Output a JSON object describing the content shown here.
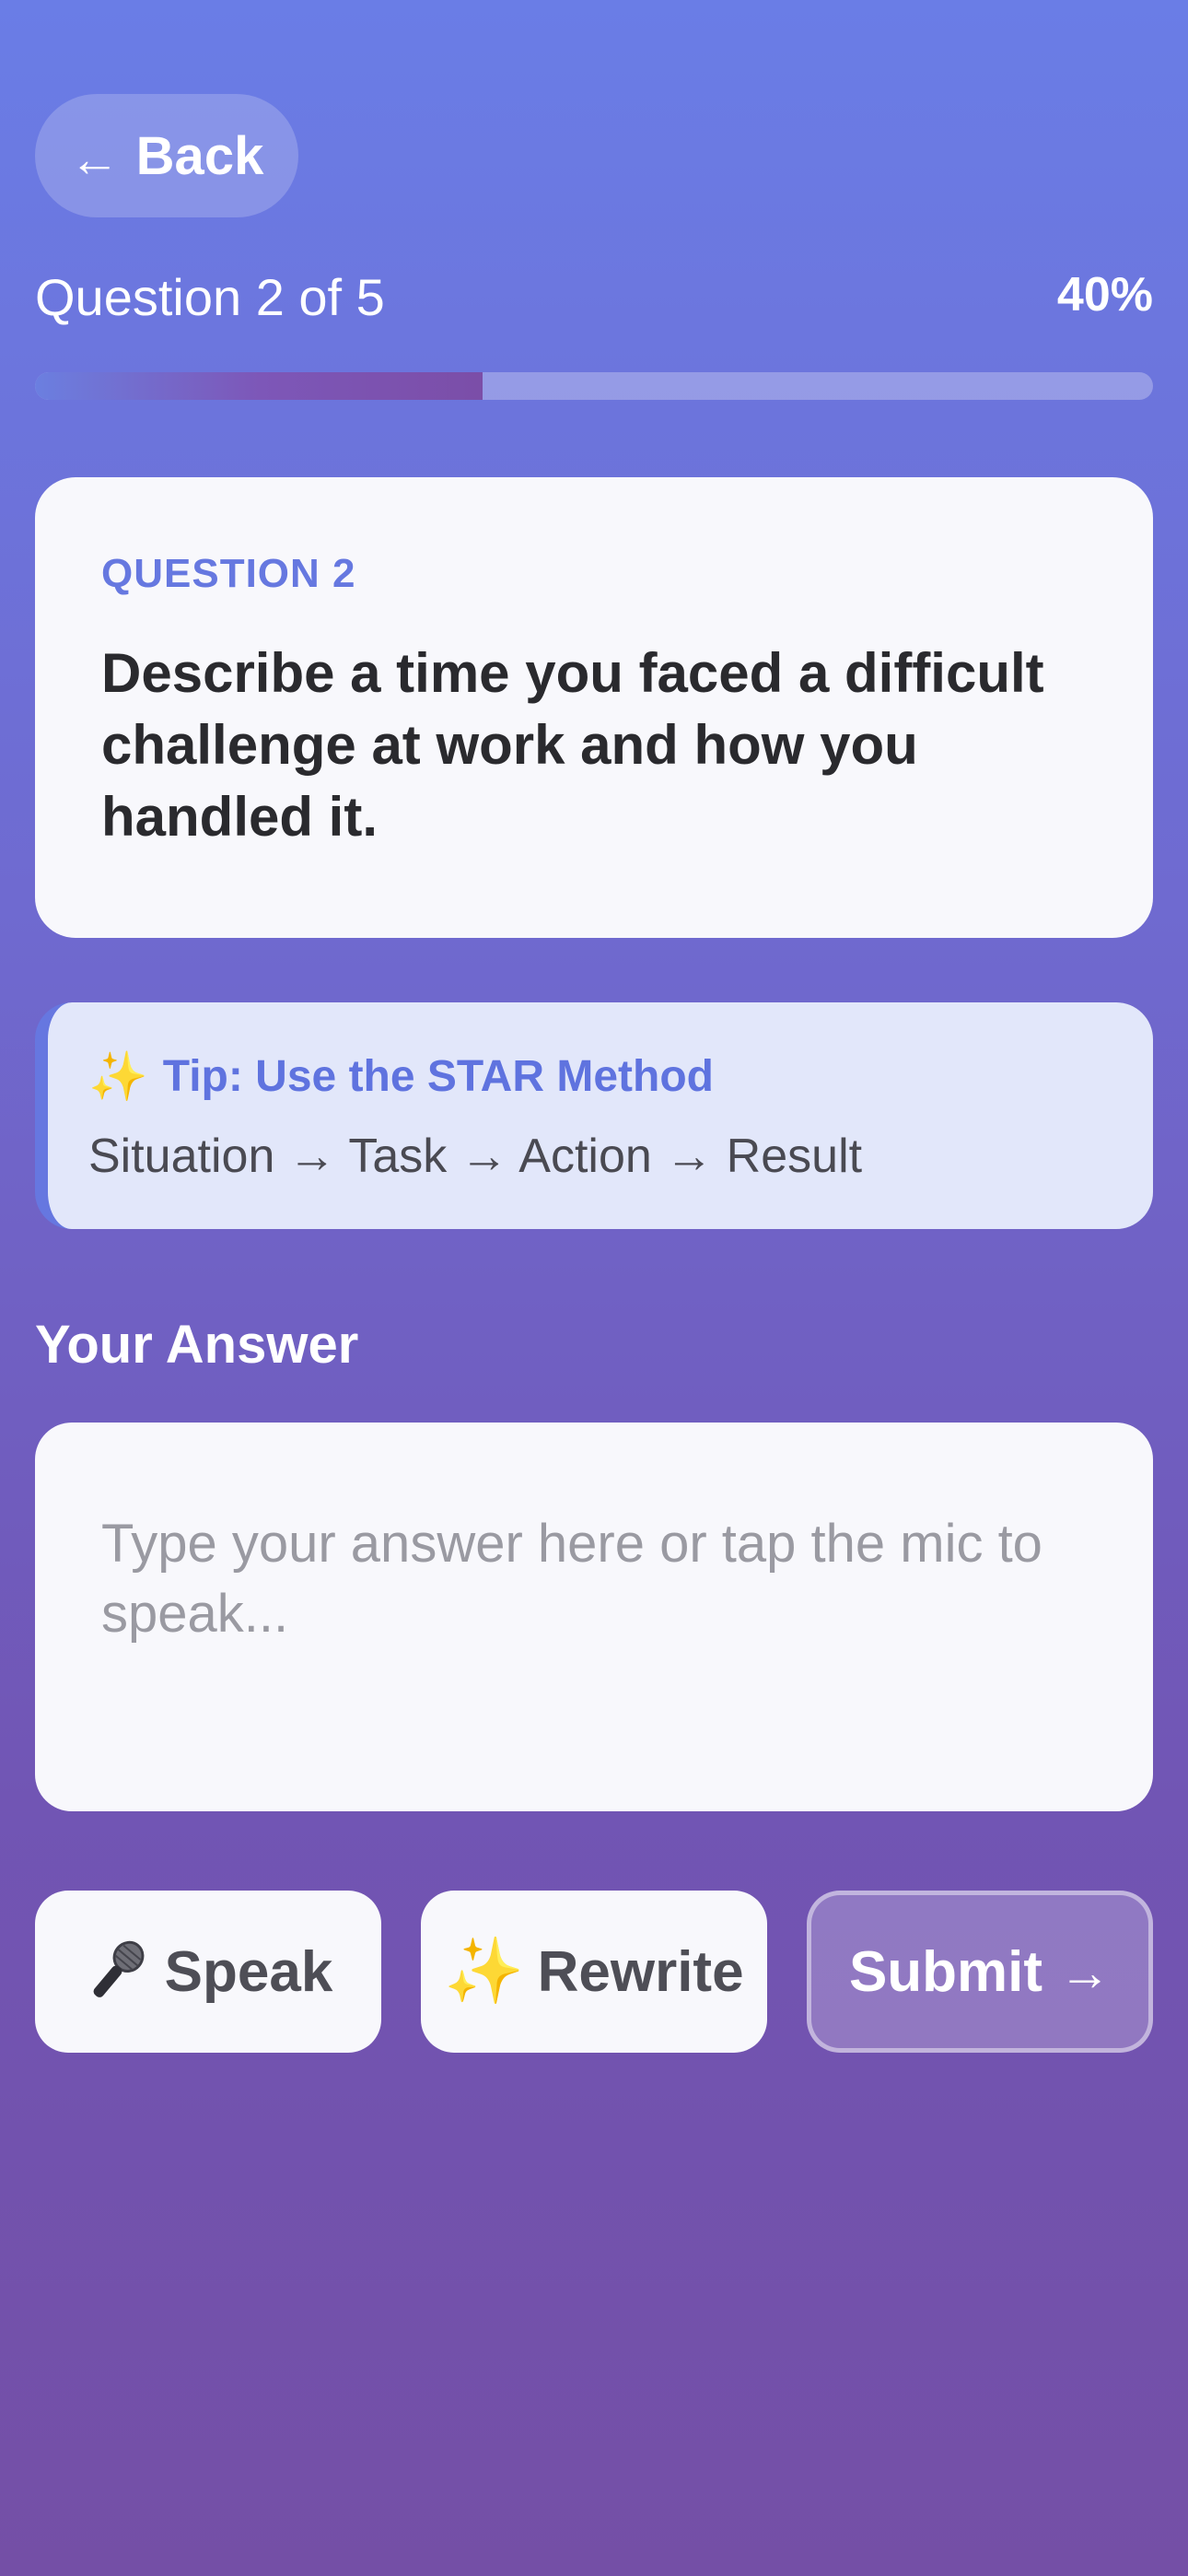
{
  "nav": {
    "back_arrow": "←",
    "back_label": "Back"
  },
  "progress": {
    "label": "Question 2 of 5",
    "percent_label": "40%",
    "fraction": 0.4
  },
  "question": {
    "number_label": "QUESTION 2",
    "text": "Describe a time you faced a difficult challenge at work and how you handled it."
  },
  "tip": {
    "icon": "sparkles-icon",
    "sparkle": "✨",
    "title": "Tip: Use the STAR Method",
    "body": "Situation → Task → Action → Result"
  },
  "answer": {
    "section_title": "Your Answer",
    "placeholder": "Type your answer here or tap the mic to speak..."
  },
  "actions": {
    "speak_label": "Speak",
    "speak_icon": "microphone-icon",
    "rewrite_label": "Rewrite",
    "rewrite_icon": "sparkles-icon",
    "rewrite_glyph": "✨",
    "submit_label": "Submit",
    "submit_arrow": "→"
  },
  "colors": {
    "accent": "#6678e0",
    "background_top": "#6a7de6",
    "background_bottom": "#744fa6"
  }
}
